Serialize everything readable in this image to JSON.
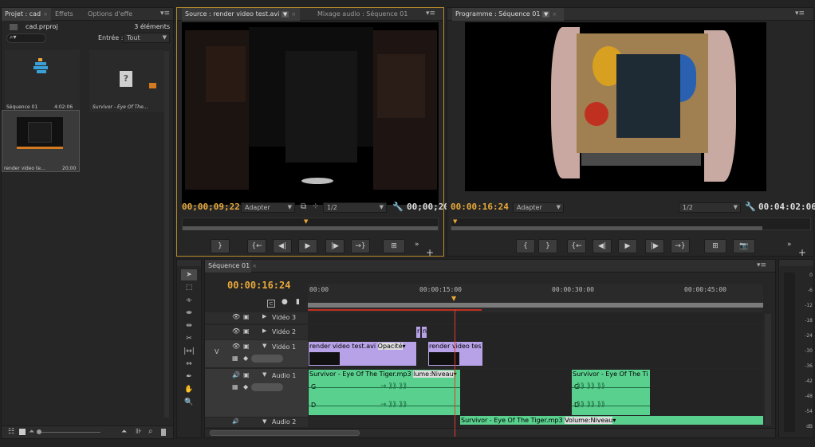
{
  "project": {
    "tabs": [
      "Projet : cad",
      "Effets",
      "Options d'effe"
    ],
    "filename": "cad.prproj",
    "count": "3 éléments",
    "search_placeholder": "",
    "entree_label": "Entrée :",
    "entree_value": "Tout",
    "items": [
      {
        "name": "Séquence 01",
        "duration": "4:02:06"
      },
      {
        "name": "Survivor - Eye Of The...",
        "duration": ""
      },
      {
        "name": "render video te...",
        "duration": "20;00"
      }
    ]
  },
  "source": {
    "tabs": [
      "Source : render video test.avi",
      "Mixage audio : Séquence 01"
    ],
    "timecode_left": "00;00;09;22",
    "fit": "Adapter",
    "res": "1/2",
    "timecode_right": "00;00;20"
  },
  "program": {
    "tab": "Programme : Séquence 01",
    "timecode_left": "00:00:16:24",
    "fit": "Adapter",
    "res": "1/2",
    "timecode_right": "00:04:02:06"
  },
  "timeline": {
    "tab": "Séquence 01",
    "timecode": "00:00:16:24",
    "ruler": [
      "00:00",
      "00:00:15:00",
      "00:00:30:00",
      "00:00:45:00"
    ],
    "tracks": [
      {
        "name": "Vidéo 3"
      },
      {
        "name": "Vidéo 2"
      },
      {
        "name": "Vidéo 1",
        "prefix": "V"
      },
      {
        "name": "Audio 1"
      },
      {
        "name": "Audio 2"
      }
    ],
    "clips": {
      "v1a": "render video test.avi",
      "v1a_fx": "Opacité",
      "v1b": "render video tes",
      "v2small": "r",
      "v2small2": "n",
      "a1a": "Survivor - Eye Of The Tiger.mp3",
      "a1a_fx": "lume:Niveau",
      "a1b": "Survivor - Eye Of The Ti",
      "a2": "Survivor - Eye Of The Tiger.mp3",
      "a2_fx": "Volume:Niveau",
      "ch_g": "G",
      "ch_d": "D"
    }
  },
  "meter": {
    "labels": [
      "0",
      "-6",
      "-12",
      "-18",
      "-24",
      "-30",
      "-36",
      "-42",
      "-48",
      "-54",
      "dB"
    ]
  },
  "colors": {
    "accent": "#e8a93a",
    "video_clip": "#b7a2e8",
    "audio_clip": "#5ad08e",
    "playhead": "#e03a2a"
  }
}
